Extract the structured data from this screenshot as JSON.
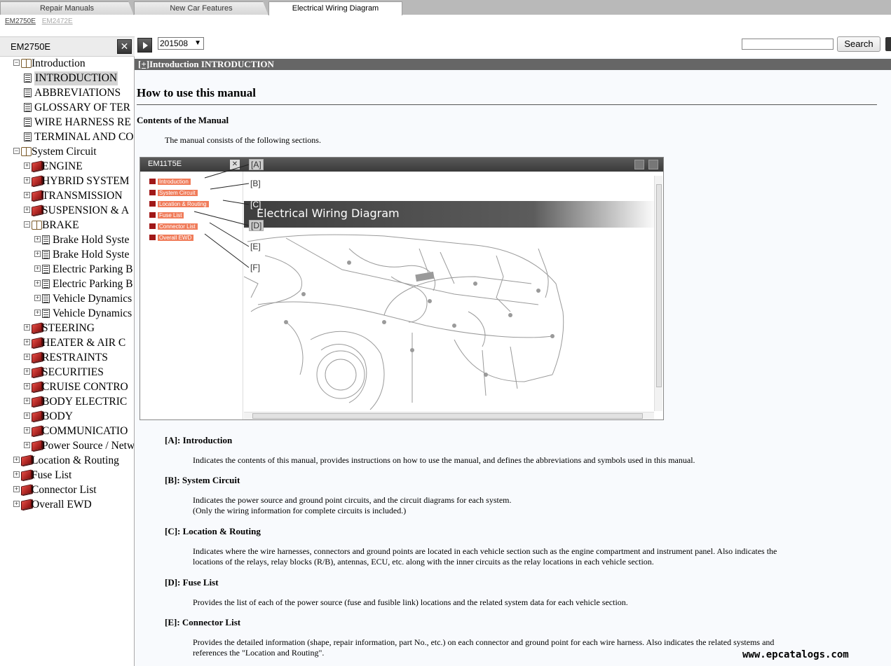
{
  "tabs": [
    {
      "label": "Repair Manuals"
    },
    {
      "label": "New Car Features"
    },
    {
      "label": "Electrical Wiring Diagram",
      "active": true
    }
  ],
  "doc_links": [
    "EM2750E",
    "EM2472E"
  ],
  "left_panel": {
    "title": "EM2750E",
    "tree": [
      {
        "label": "Introduction",
        "toggle": "−",
        "icon": "open-book"
      },
      {
        "label": "INTRODUCTION",
        "icon": "page",
        "selected": true
      },
      {
        "label": "ABBREVIATIONS",
        "icon": "page"
      },
      {
        "label": "GLOSSARY OF TER",
        "icon": "page"
      },
      {
        "label": "WIRE HARNESS RE",
        "icon": "page"
      },
      {
        "label": "TERMINAL AND CO",
        "icon": "page"
      },
      {
        "label": "System Circuit",
        "toggle": "−",
        "icon": "open-book"
      },
      {
        "label": "ENGINE",
        "toggle": "+",
        "icon": "book"
      },
      {
        "label": "HYBRID SYSTEM",
        "toggle": "+",
        "icon": "book"
      },
      {
        "label": "TRANSMISSION",
        "toggle": "+",
        "icon": "book"
      },
      {
        "label": "SUSPENSION & A",
        "toggle": "+",
        "icon": "book"
      },
      {
        "label": "BRAKE",
        "toggle": "−",
        "icon": "open-book"
      },
      {
        "label": "Brake Hold Syste",
        "toggle": "+",
        "icon": "page"
      },
      {
        "label": "Brake Hold Syste",
        "toggle": "+",
        "icon": "page"
      },
      {
        "label": "Electric Parking B",
        "toggle": "+",
        "icon": "page"
      },
      {
        "label": "Electric Parking B",
        "toggle": "+",
        "icon": "page"
      },
      {
        "label": "Vehicle Dynamics",
        "toggle": "+",
        "icon": "page"
      },
      {
        "label": "Vehicle Dynamics",
        "toggle": "+",
        "icon": "page"
      },
      {
        "label": "STEERING",
        "toggle": "+",
        "icon": "book"
      },
      {
        "label": "HEATER & AIR C",
        "toggle": "+",
        "icon": "book"
      },
      {
        "label": "RESTRAINTS",
        "toggle": "+",
        "icon": "book"
      },
      {
        "label": "SECURITIES",
        "toggle": "+",
        "icon": "book"
      },
      {
        "label": "CRUISE CONTRO",
        "toggle": "+",
        "icon": "book"
      },
      {
        "label": "BODY ELECTRIC",
        "toggle": "+",
        "icon": "book"
      },
      {
        "label": "BODY",
        "toggle": "+",
        "icon": "book"
      },
      {
        "label": "COMMUNICATIO",
        "toggle": "+",
        "icon": "book"
      },
      {
        "label": "Power Source / Netw",
        "toggle": "+",
        "icon": "book"
      },
      {
        "label": "Location & Routing",
        "toggle": "+",
        "icon": "book"
      },
      {
        "label": "Fuse List",
        "toggle": "+",
        "icon": "book"
      },
      {
        "label": "Connector List",
        "toggle": "+",
        "icon": "book"
      },
      {
        "label": "Overall EWD",
        "toggle": "+",
        "icon": "book"
      }
    ]
  },
  "toolbar": {
    "version_value": "201508",
    "search_value": "",
    "search_label": "Search"
  },
  "content": {
    "section_toggle": "[+]",
    "section_title": "Introduction  INTRODUCTION",
    "heading": "How to use this manual",
    "subheading": "Contents of the Manual",
    "intro": "The manual consists of the following sections.",
    "figure": {
      "title": "EM11T5E",
      "menu": [
        "Introduction",
        "System Circuit",
        "Location & Routing",
        "Fuse List",
        "Connector List",
        "Overall EWD"
      ],
      "callouts": [
        "[A]",
        "[B]",
        "[C]",
        "[D]",
        "[E]",
        "[F]"
      ],
      "banner": "Electrical Wiring Diagram"
    },
    "sections": [
      {
        "title": "[A]: Introduction",
        "lines": [
          "Indicates the contents of this manual, provides instructions on how to use the manual, and defines the abbreviations and symbols used in this manual."
        ]
      },
      {
        "title": "[B]: System Circuit",
        "lines": [
          "Indicates the power source and ground point circuits, and the circuit diagrams for each system.",
          "(Only the wiring information for complete circuits is included.)"
        ]
      },
      {
        "title": "[C]: Location & Routing",
        "lines": [
          "Indicates where the wire harnesses, connectors and ground points are located in each vehicle section such as the engine compartment and instrument panel. Also indicates the",
          "locations of the relays, relay blocks (R/B), antennas, ECU, etc. along with the inner circuits as the relay locations in each vehicle section."
        ]
      },
      {
        "title": "[D]: Fuse List",
        "lines": [
          "Provides the list of each of the power source (fuse and fusible link) locations and the related system data for each vehicle section."
        ]
      },
      {
        "title": "[E]: Connector List",
        "lines": [
          "Provides the detailed information (shape, repair information, part No., etc.) on each connector and ground point for each wire harness. Also indicates the related systems and",
          "references the \"Location and Routing\"."
        ]
      }
    ]
  },
  "watermark": "www.epcatalogs.com"
}
